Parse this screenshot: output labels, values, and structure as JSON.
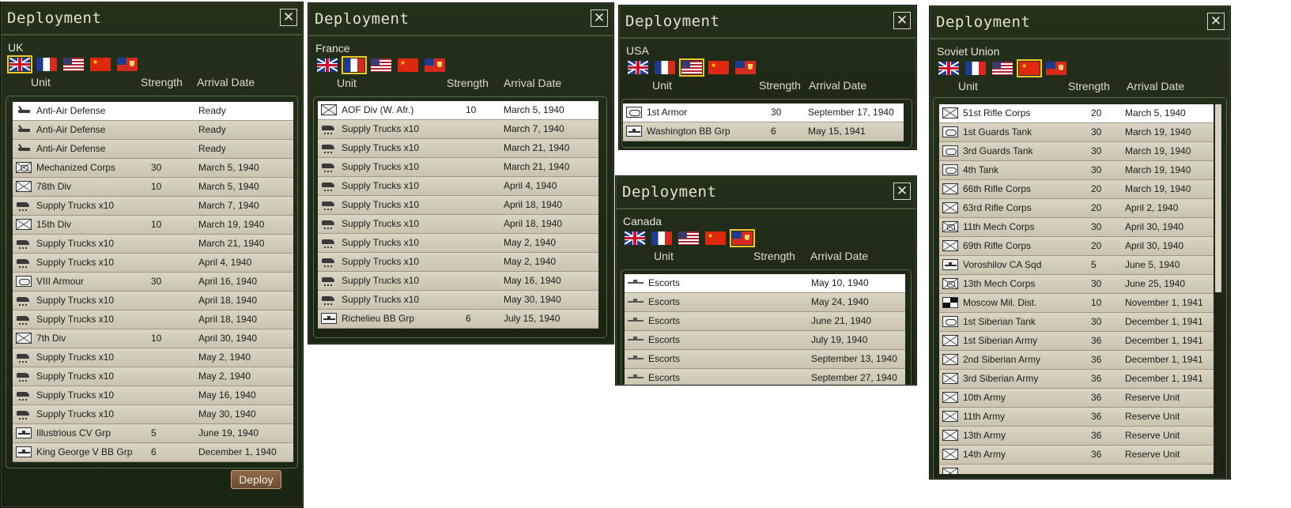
{
  "panel_title": "Deployment",
  "column_headers": {
    "unit": "Unit",
    "strength": "Strength",
    "arrival": "Arrival Date"
  },
  "deploy_label": "Deploy",
  "flags": [
    "uk",
    "fr",
    "us",
    "cn",
    "ca"
  ],
  "panels": [
    {
      "country": "UK",
      "selected_flag": "uk",
      "rows": [
        {
          "icon": "aa",
          "name": "Anti-Air Defense",
          "strength": "",
          "date": "Ready"
        },
        {
          "icon": "aa",
          "name": "Anti-Air Defense",
          "strength": "",
          "date": "Ready"
        },
        {
          "icon": "aa",
          "name": "Anti-Air Defense",
          "strength": "",
          "date": "Ready"
        },
        {
          "icon": "mech",
          "name": "Mechanized Corps",
          "strength": "30",
          "date": "March 5, 1940"
        },
        {
          "icon": "inf",
          "name": "78th Div",
          "strength": "10",
          "date": "March 5, 1940"
        },
        {
          "icon": "truck",
          "name": "Supply Trucks x10",
          "strength": "",
          "date": "March 7, 1940"
        },
        {
          "icon": "inf",
          "name": "15th Div",
          "strength": "10",
          "date": "March 19, 1940"
        },
        {
          "icon": "truck",
          "name": "Supply Trucks x10",
          "strength": "",
          "date": "March 21, 1940"
        },
        {
          "icon": "truck",
          "name": "Supply Trucks x10",
          "strength": "",
          "date": "April 4, 1940"
        },
        {
          "icon": "armor",
          "name": "VIII Armour",
          "strength": "30",
          "date": "April 16, 1940"
        },
        {
          "icon": "truck",
          "name": "Supply Trucks x10",
          "strength": "",
          "date": "April 18, 1940"
        },
        {
          "icon": "truck",
          "name": "Supply Trucks x10",
          "strength": "",
          "date": "April 18, 1940"
        },
        {
          "icon": "inf",
          "name": "7th Div",
          "strength": "10",
          "date": "April 30, 1940"
        },
        {
          "icon": "truck",
          "name": "Supply Trucks x10",
          "strength": "",
          "date": "May 2, 1940"
        },
        {
          "icon": "truck",
          "name": "Supply Trucks x10",
          "strength": "",
          "date": "May 2, 1940"
        },
        {
          "icon": "truck",
          "name": "Supply Trucks x10",
          "strength": "",
          "date": "May 16, 1940"
        },
        {
          "icon": "truck",
          "name": "Supply Trucks x10",
          "strength": "",
          "date": "May 30, 1940"
        },
        {
          "icon": "ship",
          "name": "Illustrious CV Grp",
          "strength": "5",
          "date": "June 19, 1940"
        },
        {
          "icon": "ship",
          "name": "King George V BB Grp",
          "strength": "6",
          "date": "December 1, 1940"
        }
      ]
    },
    {
      "country": "France",
      "selected_flag": "fr",
      "rows": [
        {
          "icon": "inf",
          "name": "AOF Div (W. Afr.)",
          "strength": "10",
          "date": "March 5, 1940"
        },
        {
          "icon": "truck",
          "name": "Supply Trucks x10",
          "strength": "",
          "date": "March 7, 1940"
        },
        {
          "icon": "truck",
          "name": "Supply Trucks x10",
          "strength": "",
          "date": "March 21, 1940"
        },
        {
          "icon": "truck",
          "name": "Supply Trucks x10",
          "strength": "",
          "date": "March 21, 1940"
        },
        {
          "icon": "truck",
          "name": "Supply Trucks x10",
          "strength": "",
          "date": "April 4, 1940"
        },
        {
          "icon": "truck",
          "name": "Supply Trucks x10",
          "strength": "",
          "date": "April 18, 1940"
        },
        {
          "icon": "truck",
          "name": "Supply Trucks x10",
          "strength": "",
          "date": "April 18, 1940"
        },
        {
          "icon": "truck",
          "name": "Supply Trucks x10",
          "strength": "",
          "date": "May 2, 1940"
        },
        {
          "icon": "truck",
          "name": "Supply Trucks x10",
          "strength": "",
          "date": "May 2, 1940"
        },
        {
          "icon": "truck",
          "name": "Supply Trucks x10",
          "strength": "",
          "date": "May 16, 1940"
        },
        {
          "icon": "truck",
          "name": "Supply Trucks x10",
          "strength": "",
          "date": "May 30, 1940"
        },
        {
          "icon": "ship",
          "name": "Richelieu BB Grp",
          "strength": "6",
          "date": "July 15, 1940"
        }
      ]
    },
    {
      "country": "USA",
      "selected_flag": "us",
      "rows": [
        {
          "icon": "armor",
          "name": "1st Armor",
          "strength": "30",
          "date": "September 17, 1940"
        },
        {
          "icon": "ship",
          "name": "Washington BB Grp",
          "strength": "6",
          "date": "May 15, 1941"
        }
      ]
    },
    {
      "country": "Canada",
      "selected_flag": "ca",
      "rows": [
        {
          "icon": "escort",
          "name": "Escorts",
          "strength": "",
          "date": "May 10, 1940"
        },
        {
          "icon": "escort",
          "name": "Escorts",
          "strength": "",
          "date": "May 24, 1940"
        },
        {
          "icon": "escort",
          "name": "Escorts",
          "strength": "",
          "date": "June 21, 1940"
        },
        {
          "icon": "escort",
          "name": "Escorts",
          "strength": "",
          "date": "July 19, 1940"
        },
        {
          "icon": "escort",
          "name": "Escorts",
          "strength": "",
          "date": "September 13, 1940"
        },
        {
          "icon": "escort",
          "name": "Escorts",
          "strength": "",
          "date": "September 27, 1940"
        }
      ]
    },
    {
      "country": "Soviet Union",
      "selected_flag": "cn",
      "rows": [
        {
          "icon": "inf",
          "name": "51st Rifle Corps",
          "strength": "20",
          "date": "March 5, 1940"
        },
        {
          "icon": "armor",
          "name": "1st Guards Tank",
          "strength": "30",
          "date": "March 19, 1940"
        },
        {
          "icon": "armor",
          "name": "3rd Guards Tank",
          "strength": "30",
          "date": "March 19, 1940"
        },
        {
          "icon": "armor",
          "name": "4th Tank",
          "strength": "30",
          "date": "March 19, 1940"
        },
        {
          "icon": "inf",
          "name": "66th Rifle Corps",
          "strength": "20",
          "date": "March 19, 1940"
        },
        {
          "icon": "inf",
          "name": "63rd Rifle Corps",
          "strength": "20",
          "date": "April 2, 1940"
        },
        {
          "icon": "mech",
          "name": "11th Mech Corps",
          "strength": "30",
          "date": "April 30, 1940"
        },
        {
          "icon": "inf",
          "name": "69th Rifle Corps",
          "strength": "20",
          "date": "April 30, 1940"
        },
        {
          "icon": "ship",
          "name": "Voroshilov CA Sqd",
          "strength": "5",
          "date": "June 5, 1940"
        },
        {
          "icon": "mech",
          "name": "13th Mech Corps",
          "strength": "30",
          "date": "June 25, 1940"
        },
        {
          "icon": "md",
          "name": "Moscow Mil. Dist.",
          "strength": "10",
          "date": "November 1, 1941"
        },
        {
          "icon": "armor",
          "name": "1st Siberian Tank",
          "strength": "30",
          "date": "December 1, 1941"
        },
        {
          "icon": "inf",
          "name": "1st Siberian Army",
          "strength": "36",
          "date": "December 1, 1941"
        },
        {
          "icon": "inf",
          "name": "2nd Siberian Army",
          "strength": "36",
          "date": "December 1, 1941"
        },
        {
          "icon": "inf",
          "name": "3rd Siberian Army",
          "strength": "36",
          "date": "December 1, 1941"
        },
        {
          "icon": "inf",
          "name": "10th Army",
          "strength": "36",
          "date": "Reserve Unit"
        },
        {
          "icon": "inf",
          "name": "11th Army",
          "strength": "36",
          "date": "Reserve Unit"
        },
        {
          "icon": "inf",
          "name": "13th Army",
          "strength": "36",
          "date": "Reserve Unit"
        },
        {
          "icon": "inf",
          "name": "14th Army",
          "strength": "36",
          "date": "Reserve Unit"
        },
        {
          "icon": "inf",
          "name": "",
          "strength": "",
          "date": ""
        }
      ]
    }
  ]
}
